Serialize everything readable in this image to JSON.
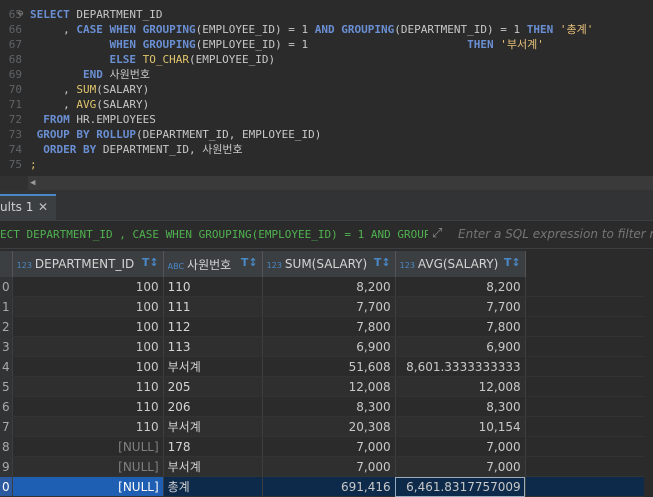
{
  "editor": {
    "lines": [
      {
        "n": "65",
        "fold": "⊖",
        "html": "<span class='kw'>SELECT</span> DEPARTMENT_ID"
      },
      {
        "n": "66",
        "fold": "",
        "html": "     , <span class='kw'>CASE WHEN</span> <span class='kw'>GROUPING</span>(EMPLOYEE_ID) = 1 <span class='kw'>AND</span> <span class='kw'>GROUPING</span>(DEPARTMENT_ID) = 1 <span class='kw'>THEN</span> <span class='str'>'총계'</span>"
      },
      {
        "n": "67",
        "fold": "",
        "html": "            <span class='kw'>WHEN</span> <span class='kw'>GROUPING</span>(EMPLOYEE_ID) = 1                        <span class='kw'>THEN</span> <span class='str'>'부서계'</span>"
      },
      {
        "n": "68",
        "fold": "",
        "html": "            <span class='kw'>ELSE</span> <span class='fnY'>TO_CHAR</span>(EMPLOYEE_ID)"
      },
      {
        "n": "69",
        "fold": "",
        "html": "        <span class='kw'>END</span> 사원번호"
      },
      {
        "n": "70",
        "fold": "",
        "html": "     , <span class='fnY'>SUM</span>(SALARY)"
      },
      {
        "n": "71",
        "fold": "",
        "html": "     , <span class='fnY'>AVG</span>(SALARY)"
      },
      {
        "n": "72",
        "fold": "",
        "html": "  <span class='kw'>FROM</span> HR.EMPLOYEES"
      },
      {
        "n": "73",
        "fold": "",
        "html": " <span class='kw'>GROUP BY</span> <span class='kw'>ROLLUP</span>(DEPARTMENT_ID, EMPLOYEE_ID)"
      },
      {
        "n": "74",
        "fold": "",
        "html": "  <span class='kw'>ORDER BY</span> DEPARTMENT_ID, 사원번호"
      },
      {
        "n": "75",
        "fold": "",
        "html": "<span class='pct'>;</span>"
      }
    ]
  },
  "tab": {
    "label": "ults 1",
    "close": "✕"
  },
  "filter": {
    "query": "ECT DEPARTMENT_ID , CASE WHEN GROUPING(EMPLOYEE_ID) = 1 AND GROUPI",
    "placeholder": "Enter a SQL expression to filter results"
  },
  "grid": {
    "columns": [
      {
        "type": "123",
        "name": "DEPARTMENT_ID"
      },
      {
        "type": "ABC",
        "name": "사원번호"
      },
      {
        "type": "123",
        "name": "SUM(SALARY)"
      },
      {
        "type": "123",
        "name": "AVG(SALARY)"
      }
    ],
    "rows": [
      {
        "r": "0",
        "dept": "100",
        "emp": "110",
        "sum": "8,200",
        "avg": "8,200"
      },
      {
        "r": "1",
        "dept": "100",
        "emp": "111",
        "sum": "7,700",
        "avg": "7,700"
      },
      {
        "r": "2",
        "dept": "100",
        "emp": "112",
        "sum": "7,800",
        "avg": "7,800"
      },
      {
        "r": "3",
        "dept": "100",
        "emp": "113",
        "sum": "6,900",
        "avg": "6,900"
      },
      {
        "r": "4",
        "dept": "100",
        "emp": "부서계",
        "sum": "51,608",
        "avg": "8,601.3333333333"
      },
      {
        "r": "5",
        "dept": "110",
        "emp": "205",
        "sum": "12,008",
        "avg": "12,008"
      },
      {
        "r": "6",
        "dept": "110",
        "emp": "206",
        "sum": "8,300",
        "avg": "8,300"
      },
      {
        "r": "7",
        "dept": "110",
        "emp": "부서계",
        "sum": "20,308",
        "avg": "10,154"
      },
      {
        "r": "8",
        "dept": "[NULL]",
        "emp": "178",
        "sum": "7,000",
        "avg": "7,000"
      },
      {
        "r": "9",
        "dept": "[NULL]",
        "emp": "부서계",
        "sum": "7,000",
        "avg": "7,000"
      },
      {
        "r": "0",
        "dept": "[NULL]",
        "emp": "총계",
        "sum": "691,416",
        "avg": "6,461.8317757009"
      }
    ]
  }
}
